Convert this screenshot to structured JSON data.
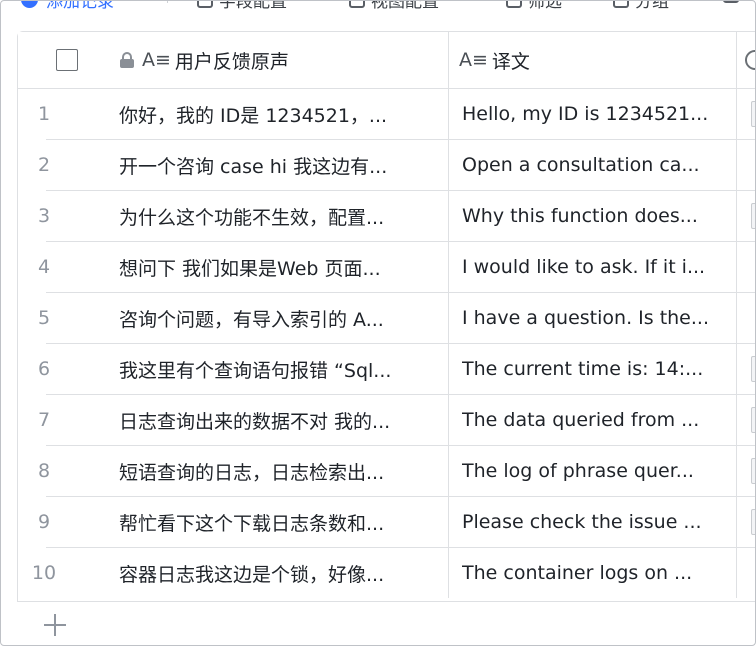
{
  "toolbar": {
    "add_label": "添加记录",
    "field_config_label": "字段配置",
    "view_config_label": "视图配置",
    "filter_label": "筛选",
    "group_label": "分组"
  },
  "columns": {
    "text_header": "用户反馈原声",
    "translation_header": "译文"
  },
  "rows": [
    {
      "index": "1",
      "text": "你好，我的 ID是 1234521，...",
      "translation": "Hello, my ID is 1234521..."
    },
    {
      "index": "2",
      "text": "开一个咨询 case hi 我这边有...",
      "translation": "Open a consultation ca..."
    },
    {
      "index": "3",
      "text": "为什么这个功能不生效，配置...",
      "translation": "Why this function does..."
    },
    {
      "index": "4",
      "text": "想问下 我们如果是Web 页面...",
      "translation": "I would like to ask. If it i..."
    },
    {
      "index": "5",
      "text": "咨询个问题，有导入索引的 A...",
      "translation": "I have a question. Is the..."
    },
    {
      "index": "6",
      "text": "我这里有个查询语句报错 “Sql...",
      "translation": "The current time is: 14:..."
    },
    {
      "index": "7",
      "text": "日志查询出来的数据不对 我的...",
      "translation": "The data queried from ..."
    },
    {
      "index": "8",
      "text": "短语查询的日志，日志检索出...",
      "translation": "The log of phrase quer..."
    },
    {
      "index": "9",
      "text": "帮忙看下这个下载日志条数和...",
      "translation": "Please check the issue ..."
    },
    {
      "index": "10",
      "text": "容器日志我这边是个锁，好像...",
      "translation": "The container logs on ..."
    }
  ],
  "icons": {
    "lock": "lock-icon",
    "text_field": "text-field-icon",
    "attachment": "paperclip-icon",
    "add_row": "plus-icon"
  },
  "colors": {
    "accent": "#3370ff",
    "border": "#dee0e3",
    "muted_text": "#8f959e"
  }
}
